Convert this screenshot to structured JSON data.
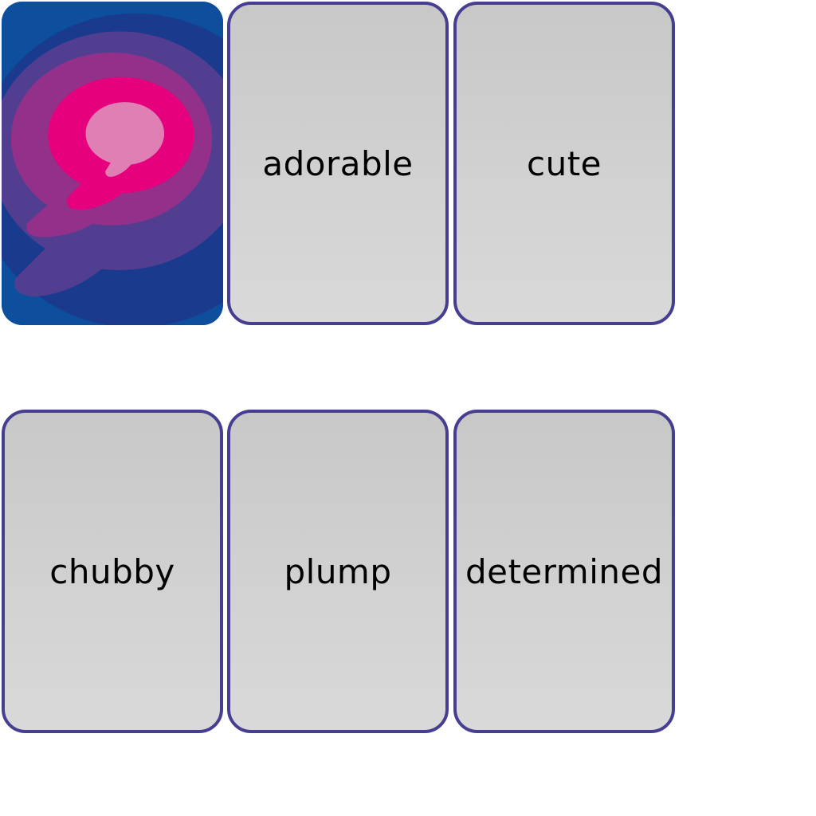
{
  "cards": [
    {
      "state": "face-down",
      "back_icon": "speech-bubble-icon"
    },
    {
      "state": "face-up",
      "word": "adorable"
    },
    {
      "state": "face-up",
      "word": "cute"
    },
    {
      "state": "face-up",
      "word": "chubby"
    },
    {
      "state": "face-up",
      "word": "plump"
    },
    {
      "state": "face-up",
      "word": "determined"
    }
  ],
  "colors": {
    "card_border": "#453e91",
    "card_face_top": "#c8c8c8",
    "card_face_bottom": "#d9d9d9",
    "back_blue": "#0d4f9c",
    "back_navy": "#1a3a8e",
    "back_purple": "#523e91",
    "back_magenta": "#93308a",
    "back_pink": "#e6007e",
    "back_light_pink": "#e07fb4"
  }
}
